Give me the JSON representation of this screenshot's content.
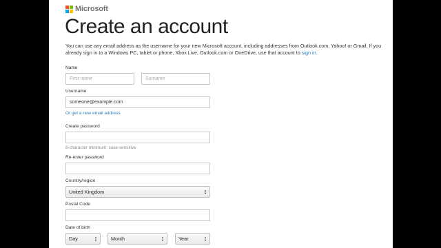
{
  "brand": {
    "name": "Microsoft",
    "colors": [
      "#f25022",
      "#7fba00",
      "#00a4ef",
      "#ffb900"
    ]
  },
  "title": "Create an account",
  "intro": {
    "text": "You can use any email address as the username for your new Microsoft account, including addresses from Outlook.com, Yahoo! or Gmail. If you already sign in to a Windows PC, tablet or phone, Xbox Live, Outlook.com or OneDrive, use that account to ",
    "link": "sign in."
  },
  "form": {
    "name_label": "Name",
    "first_name_placeholder": "First name",
    "surname_placeholder": "Surname",
    "username_label": "Username",
    "username_value": "someone@example.com",
    "new_email_link": "Or get a new email address",
    "password_label": "Create password",
    "password_hint": "8-character minimum; case-sensitive",
    "reenter_label": "Re-enter password",
    "country_label": "Country/region",
    "country_value": "United Kingdom",
    "postal_label": "Postal Code",
    "dob_label": "Date of birth",
    "day_value": "Day",
    "month_value": "Month",
    "year_value": "Year"
  }
}
